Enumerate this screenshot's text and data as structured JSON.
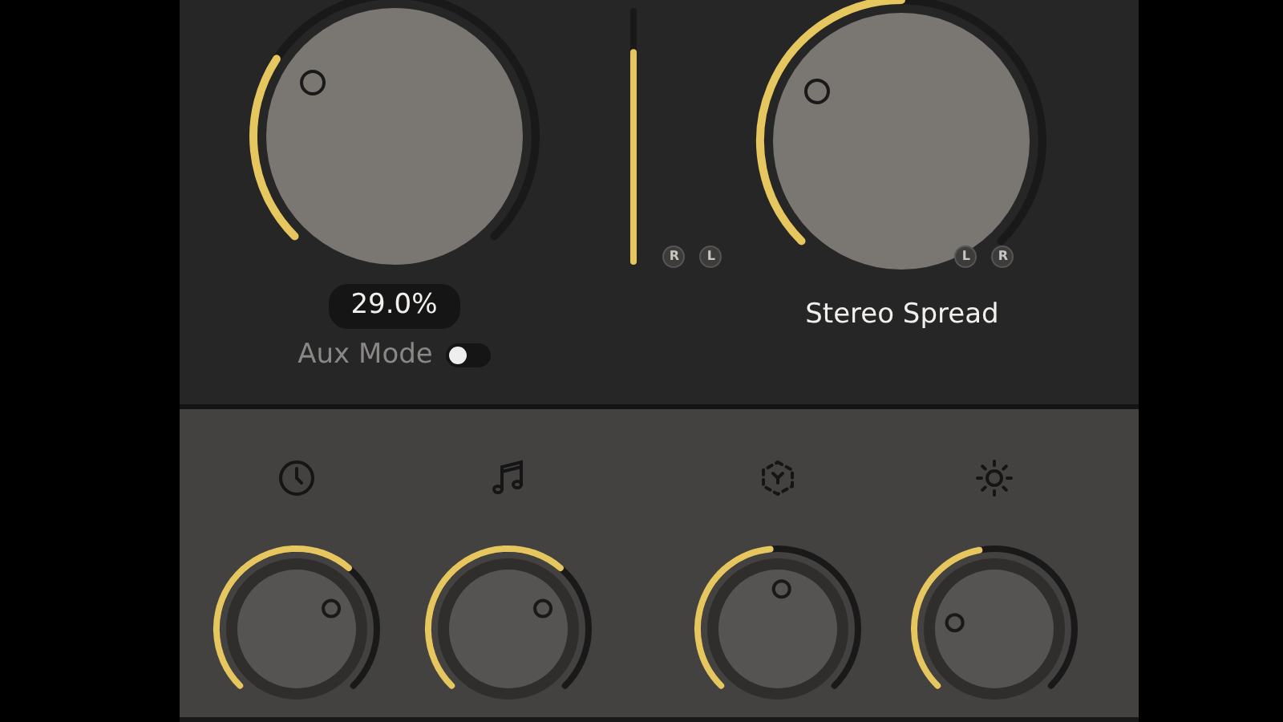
{
  "mix_knob": {
    "value": "29.0%"
  },
  "aux_mode": {
    "label": "Aux Mode",
    "on": false
  },
  "meter": {
    "level": 0.84
  },
  "spread_knob": {
    "label": "Stereo Spread",
    "badges_left": [
      "R",
      "L"
    ],
    "badges_right": [
      "L",
      "R"
    ]
  }
}
